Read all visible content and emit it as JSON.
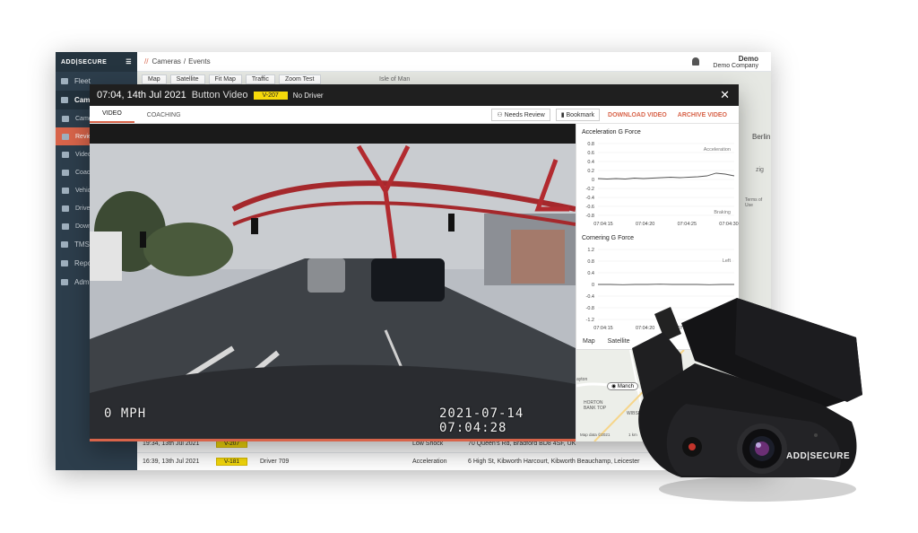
{
  "app": {
    "logo": "ADD|SECURE",
    "breadcrumb": [
      "Cameras",
      "Events"
    ],
    "user": {
      "name": "Demo",
      "company": "Demo Company"
    },
    "map_tabs": [
      "Map",
      "Satellite",
      "Fit Map",
      "Traffic",
      "Zoom Test"
    ],
    "map_labels": [
      "Isle of Man",
      "Berlin",
      "zig",
      "Terms of Use"
    ],
    "sidebar": {
      "items": [
        {
          "label": "Fleet",
          "active": false
        },
        {
          "label": "Cameras",
          "active": true
        },
        {
          "label": "Cameras",
          "sub": true
        },
        {
          "label": "Review",
          "sub": true,
          "selected": true
        },
        {
          "label": "Videos",
          "sub": true
        },
        {
          "label": "Coaching",
          "sub": true
        },
        {
          "label": "Vehicles",
          "sub": true
        },
        {
          "label": "Drivers",
          "sub": true
        },
        {
          "label": "Downloads",
          "sub": true
        },
        {
          "label": "TMS"
        },
        {
          "label": "Reports"
        },
        {
          "label": "Admin"
        }
      ]
    },
    "events": [
      {
        "time": "19:34, 13th Jul 2021",
        "vehicle": "V-207",
        "driver": "",
        "type": "Low Shock",
        "location": "70 Queen's Rd, Bradford BD8 4SF, UK"
      },
      {
        "time": "16:39, 13th Jul 2021",
        "vehicle": "V-181",
        "driver": "Driver 709",
        "type": "Acceleration",
        "location": "6 High St, Kibworth Harcourt, Kibworth Beauchamp, Leicester"
      }
    ]
  },
  "modal": {
    "time": "07:04, 14th Jul 2021",
    "type": "Button Video",
    "vehicle": "V-207",
    "driver": "No Driver",
    "close": "✕",
    "tabs": [
      "VIDEO",
      "COACHING"
    ],
    "actions": {
      "needs_review": "Needs Review",
      "bookmark": "Bookmark",
      "download": "DOWNLOAD VIDEO",
      "archive": "ARCHIVE VIDEO"
    },
    "video": {
      "speed": "0 MPH",
      "timestamp": "2021-07-14 07:04:28",
      "progress": 1.0
    },
    "map_tabs": [
      "Map",
      "Satellite"
    ],
    "map_labels": [
      "Manch",
      "HORTON BANK TOP",
      "Map data ©2021",
      "1 km",
      "WIBSEY",
      "ayton"
    ]
  },
  "chart_data": [
    {
      "type": "line",
      "title": "Acceleration G Force",
      "x": [
        "07:04:15",
        "07:04:20",
        "07:04:25",
        "07:04:30"
      ],
      "ylim": [
        -0.8,
        0.8
      ],
      "yticks": [
        "0.8",
        "0.6",
        "0.4",
        "0.2",
        "0",
        "-0.2",
        "-0.4",
        "-0.6",
        "-0.8"
      ],
      "annotations": [
        "Acceleration",
        "Braking"
      ],
      "series": [
        {
          "values": [
            0.02,
            0.01,
            0.02,
            0.01,
            0.03,
            0.02,
            0.03,
            0.04,
            0.05,
            0.04,
            0.05,
            0.06,
            0.08,
            0.14,
            0.12,
            0.08
          ]
        }
      ]
    },
    {
      "type": "line",
      "title": "Cornering G Force",
      "x": [
        "07:04:15",
        "07:04:20",
        "07:04:25",
        "07:04:30"
      ],
      "ylim": [
        -1.2,
        1.2
      ],
      "yticks": [
        "1.2",
        "0.8",
        "0.4",
        "0",
        "-0.4",
        "-0.8",
        "-1.2"
      ],
      "annotations": [
        "Left"
      ],
      "series": [
        {
          "values": [
            0.0,
            0.0,
            -0.01,
            0.0,
            0.0,
            0.01,
            0.0,
            0.0,
            0.0,
            -0.01,
            0.0,
            0.0
          ]
        }
      ]
    }
  ],
  "device": {
    "brand": "ADD|SECURE"
  },
  "colors": {
    "accent": "#d8644a",
    "vehicle_tag": "#f5d90b",
    "sidebar": "#2d3e4c"
  }
}
